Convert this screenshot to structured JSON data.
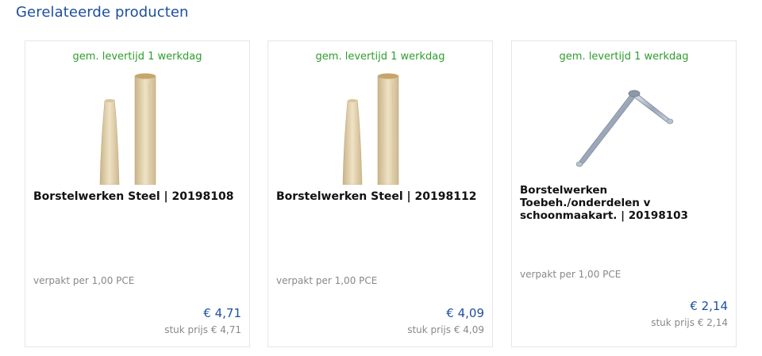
{
  "section": {
    "title": "Gerelateerde producten"
  },
  "colors": {
    "accent": "#1d4f9c",
    "delivery": "#2e9d2e",
    "muted": "#888888"
  },
  "products": [
    {
      "delivery": "gem. levertijd 1 werkdag",
      "image_icon": "wooden-handle-image",
      "name": "Borstelwerken Steel | 20198108",
      "packed": "verpakt per 1,00 PCE",
      "price": "€ 4,71",
      "unit_price": "stuk prijs € 4,71"
    },
    {
      "delivery": "gem. levertijd 1 werkdag",
      "image_icon": "wooden-handle-image",
      "name": "Borstelwerken Steel | 20198112",
      "packed": "verpakt per 1,00 PCE",
      "price": "€ 4,09",
      "unit_price": "stuk prijs € 4,09"
    },
    {
      "delivery": "gem. levertijd 1 werkdag",
      "image_icon": "metal-bracket-image",
      "name_lines": [
        "Borstelwerken",
        "Toebeh./onderdelen v",
        "schoonmaakart. | 20198103"
      ],
      "packed": "verpakt per 1,00 PCE",
      "price": "€ 2,14",
      "unit_price": "stuk prijs € 2,14"
    }
  ]
}
